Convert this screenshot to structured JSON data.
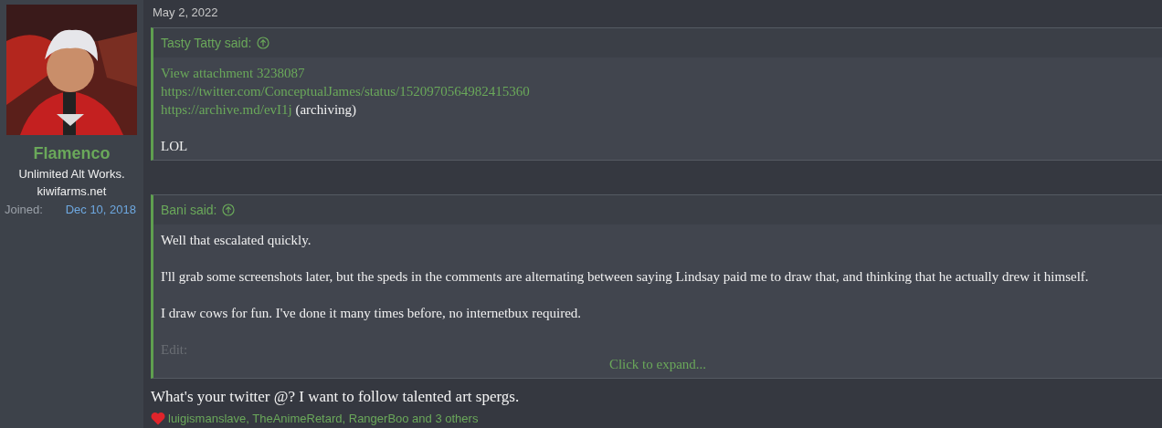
{
  "user": {
    "name": "Flamenco",
    "title": "Unlimited Alt Works.",
    "site": "kiwifarms.net",
    "joined_label": "Joined:",
    "joined_value": "Dec 10, 2018"
  },
  "post": {
    "date": "May 2, 2022",
    "quotes": [
      {
        "author_line": "Tasty Tatty said:",
        "paragraphs": [
          [
            [
              {
                "kind": "link",
                "text": "View attachment 3238087"
              }
            ],
            [
              {
                "kind": "link",
                "text": "https://twitter.com/ConceptualJames/status/1520970564982415360"
              }
            ],
            [
              {
                "kind": "link",
                "text": "https://archive.md/evI1j"
              },
              {
                "kind": "text",
                "text": " (archiving)"
              }
            ]
          ],
          [
            [
              {
                "kind": "text",
                "text": "LOL"
              }
            ]
          ]
        ]
      },
      {
        "author_line": "Bani said:",
        "paragraphs": [
          [
            [
              {
                "kind": "text",
                "text": "Well that escalated quickly."
              }
            ]
          ],
          [
            [
              {
                "kind": "text",
                "text": "I'll grab some screenshots later, but the speds in the comments are alternating between saying Lindsay paid me to draw that, and thinking that he actually drew it himself."
              }
            ]
          ],
          [
            [
              {
                "kind": "text",
                "text": "I draw cows for fun. I've done it many times before, no internetbux required."
              }
            ]
          ],
          [
            [
              {
                "kind": "faded",
                "text": "Edit:"
              }
            ]
          ]
        ],
        "expand": "Click to expand..."
      }
    ],
    "reply": "What's your twitter @? I want to follow talented art spergs.",
    "reactions": "luigismanslave, TheAnimeRetard, RangerBoo and 3 others"
  }
}
